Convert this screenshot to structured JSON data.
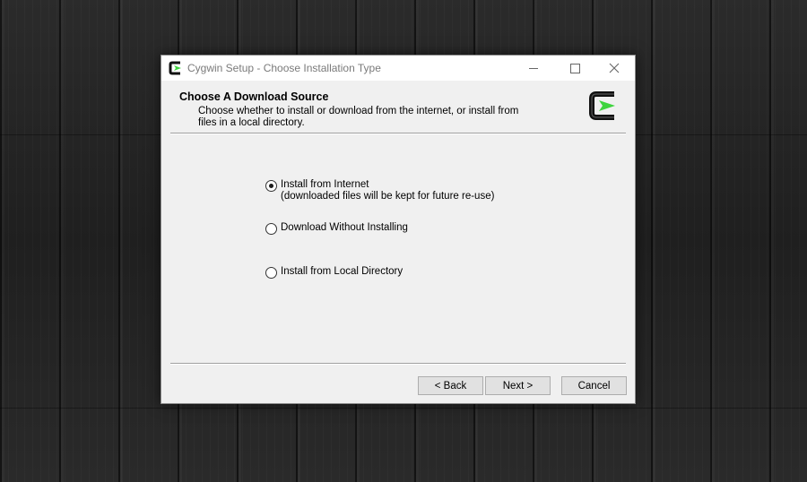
{
  "window": {
    "title": "Cygwin Setup - Choose Installation Type"
  },
  "header": {
    "title": "Choose A Download Source",
    "description": "Choose whether to install or download from the internet, or install from files in a local directory."
  },
  "options": [
    {
      "label": "Install from Internet",
      "sublabel": "(downloaded files will be kept for future re-use)",
      "selected": true
    },
    {
      "label": "Download Without Installing",
      "sublabel": "",
      "selected": false
    },
    {
      "label": "Install from Local Directory",
      "sublabel": "",
      "selected": false
    }
  ],
  "buttons": {
    "back": "< Back",
    "next": "Next >",
    "cancel": "Cancel"
  },
  "icons": {
    "app": "cygwin-logo-icon",
    "header_logo": "cygwin-logo-icon",
    "minimize": "minimize-icon",
    "maximize": "maximize-icon",
    "close": "close-icon"
  },
  "colors": {
    "logo_accent": "#3ed43e"
  }
}
